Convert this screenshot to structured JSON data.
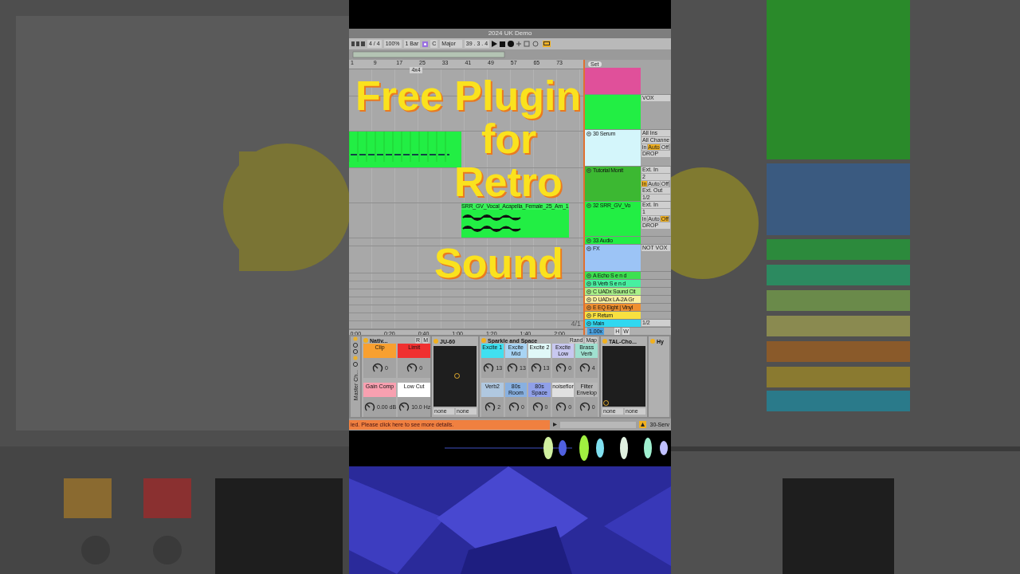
{
  "title": "2024 UK Demo",
  "toolbar": {
    "meter": "4 / 4",
    "zoom": "100%",
    "quantize": "1 Bar",
    "key": "C",
    "scale": "Major",
    "position": "39 . 3 . 4",
    "loop_on": true
  },
  "ruler": {
    "bars": [
      "1",
      "9",
      "17",
      "25",
      "33",
      "41",
      "49",
      "57",
      "65",
      "73"
    ],
    "marker": "4x4",
    "set_button": "Set"
  },
  "overlay_title": [
    "Free Plugin",
    "for",
    "Retro",
    "Sound"
  ],
  "tracks": [
    {
      "kind": "group",
      "color": "#e0509a"
    },
    {
      "kind": "audio",
      "color": "#22ee44",
      "controls": [
        {
          "kind": "dropdown",
          "text": "VOX"
        }
      ]
    },
    {
      "kind": "midi",
      "name": "30 Serum",
      "color": "#d4f6fb",
      "controls": [
        {
          "kind": "dropdown",
          "text": "All Ins"
        },
        {
          "kind": "dropdown",
          "text": "All Channe"
        },
        {
          "kind": "toggles",
          "items": [
            {
              "label": "In",
              "on": false
            },
            {
              "label": "Auto",
              "on": true
            },
            {
              "label": "Off",
              "on": false
            }
          ]
        },
        {
          "kind": "dropdown",
          "text": "DROP"
        }
      ],
      "clips": [
        {
          "kind": "midi"
        }
      ]
    },
    {
      "kind": "audio",
      "name": "Tutorial Monit",
      "color": "#3cb832",
      "controls": [
        {
          "kind": "dropdown",
          "text": "Ext. In"
        },
        {
          "kind": "dropdown",
          "text": "2"
        },
        {
          "kind": "toggles",
          "items": [
            {
              "label": "In",
              "on": true
            },
            {
              "label": "Auto",
              "on": false
            },
            {
              "label": "Off",
              "on": false
            }
          ]
        },
        {
          "kind": "dropdown",
          "text": "Ext. Out"
        },
        {
          "kind": "dropdown",
          "text": "1/2"
        }
      ]
    },
    {
      "kind": "audio",
      "name": "32 SRR_GV_Vo",
      "color": "#22ee44",
      "controls": [
        {
          "kind": "dropdown",
          "text": "Ext. In"
        },
        {
          "kind": "dropdown",
          "text": "1"
        },
        {
          "kind": "toggles",
          "items": [
            {
              "label": "In",
              "on": false
            },
            {
              "label": "Auto",
              "on": false
            },
            {
              "label": "Off",
              "on": true
            }
          ]
        },
        {
          "kind": "dropdown",
          "text": "DROP"
        }
      ],
      "clips": [
        {
          "kind": "audio",
          "name": "SRR_GV_Vocal_Acapella_Female_25_Am_1"
        }
      ]
    },
    {
      "kind": "folded",
      "name": "33 Audio",
      "color": "#22ee44"
    },
    {
      "kind": "group",
      "name": "FX",
      "color": "#9cc4f6",
      "controls": [
        {
          "kind": "dropdown",
          "text": "NOT VOX"
        }
      ]
    },
    {
      "kind": "return",
      "name": "A Echo S e n d",
      "color": "#3de050"
    },
    {
      "kind": "return",
      "name": "B Verb S e n d",
      "color": "#48f0a0"
    },
    {
      "kind": "return",
      "name": "C UADx Sound Cit",
      "color": "#a8f088"
    },
    {
      "kind": "return",
      "name": "D UADx LA-2A Gr",
      "color": "#f8f0a0"
    },
    {
      "kind": "return",
      "name": "E EQ Eight | Vinyl",
      "color": "#f09030"
    },
    {
      "kind": "return",
      "name": "F Return",
      "color": "#f8e040"
    },
    {
      "kind": "return",
      "name": "Main",
      "color": "#30d8f0",
      "controls": [
        {
          "kind": "dropdown",
          "text": "1/2"
        }
      ]
    }
  ],
  "arrangement": {
    "loop_label": "4/1",
    "time_labels": [
      "0:00",
      "0:20",
      "0:40",
      "1:00",
      "1:20",
      "1:40",
      "2:00"
    ]
  },
  "track_footer": {
    "tempo_factor": "1.00x",
    "buttons": [
      "H",
      "W"
    ]
  },
  "device_strip_label": "Master Ch...",
  "devices": [
    {
      "kind": "rack",
      "name": "Nativ...",
      "on": true,
      "buttons": [
        "R",
        "M"
      ],
      "macros": [
        {
          "label": "Clip",
          "color": "#f8a030",
          "value": "0"
        },
        {
          "label": "Limit",
          "color": "#f03030",
          "value": "0"
        },
        {
          "label": "Gain Comp",
          "color": "#f8a0b0",
          "value": "0.00 dB"
        },
        {
          "label": "Low Cut",
          "color": "#ffffff",
          "value": "10.0 Hz"
        }
      ]
    },
    {
      "kind": "xy",
      "name": "JU-60",
      "on": true,
      "selects": [
        "none",
        "none"
      ]
    },
    {
      "kind": "rack",
      "name": "Sparkle and Space",
      "on": true,
      "buttons": [
        "Rand",
        "Map"
      ],
      "macros": [
        {
          "label": "Excite 1",
          "color": "#40e0f0",
          "value": "13"
        },
        {
          "label": "Excite Mid",
          "color": "#a8d4f4",
          "value": "13"
        },
        {
          "label": "Excite 2",
          "color": "#e0f8f8",
          "value": "13"
        },
        {
          "label": "Excite Low",
          "color": "#c8c8f0",
          "value": "0"
        },
        {
          "label": "Brass Verb",
          "color": "#a0e0d0",
          "value": "4"
        },
        {
          "label": "Verb2",
          "color": "#b0c8e0",
          "value": "2"
        },
        {
          "label": "80s Room",
          "color": "#88b0e0",
          "value": "0"
        },
        {
          "label": "80s Space",
          "color": "#90a0e8",
          "value": "0"
        },
        {
          "label": "noiseflor",
          "color": "#e0e0e0",
          "value": "0"
        },
        {
          "label": "Filter Envelop",
          "color": "#b8b8b8",
          "value": "0"
        }
      ]
    },
    {
      "kind": "xy",
      "name": "TAL-Cho...",
      "on": true,
      "selects": [
        "none",
        "none"
      ]
    },
    {
      "kind": "stub",
      "name": "Hy",
      "on": true
    }
  ],
  "status_bar": {
    "message": "ied. Please click here to see more details.",
    "right_text": "30-Serv"
  }
}
